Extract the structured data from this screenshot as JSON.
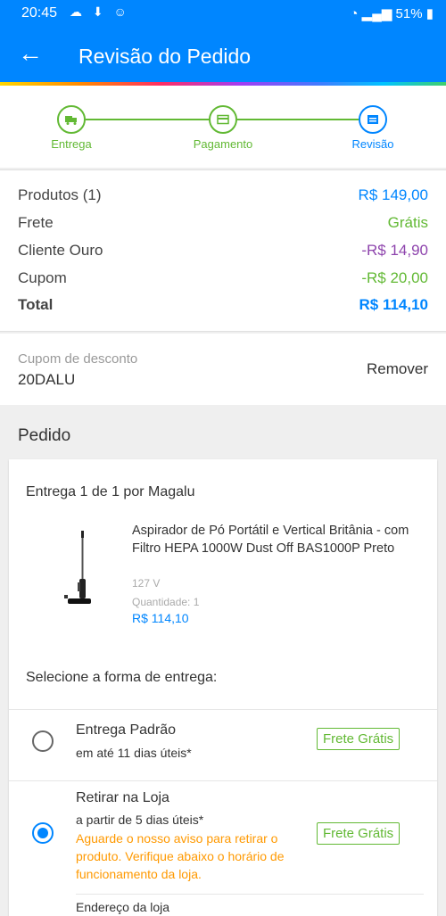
{
  "status_bar": {
    "time": "20:45",
    "battery": "51%"
  },
  "header": {
    "title": "Revisão do Pedido"
  },
  "stepper": {
    "steps": [
      {
        "label": "Entrega",
        "icon": "truck-icon"
      },
      {
        "label": "Pagamento",
        "icon": "card-icon"
      },
      {
        "label": "Revisão",
        "icon": "review-icon"
      }
    ]
  },
  "summary": {
    "rows": [
      {
        "label": "Produtos (1)",
        "value": "R$ 149,00",
        "color": "#0086ff"
      },
      {
        "label": "Frete",
        "value": "Grátis",
        "color": "#62b934"
      },
      {
        "label": "Cliente Ouro",
        "value": "-R$ 14,90",
        "color": "#8e44ad"
      },
      {
        "label": "Cupom",
        "value": "-R$ 20,00",
        "color": "#62b934"
      }
    ],
    "total": {
      "label": "Total",
      "value": "R$ 114,10",
      "color": "#0086ff"
    }
  },
  "coupon": {
    "label": "Cupom de desconto",
    "code": "20DALU",
    "remove_label": "Remover"
  },
  "order": {
    "section_title": "Pedido",
    "delivery_info": "Entrega 1 de 1 por Magalu",
    "product": {
      "name": "Aspirador de Pó Portátil e Vertical Britânia - com Filtro HEPA 1000W Dust Off BAS1000P Preto",
      "voltage": "127 V",
      "quantity": "Quantidade:  1",
      "price": "R$ 114,10"
    },
    "select_label": "Selecione a forma de entrega:",
    "options": [
      {
        "title": "Entrega Padrão",
        "subtitle": "em até 11 dias úteis*",
        "badge": "Frete Grátis",
        "selected": false
      },
      {
        "title": "Retirar na Loja",
        "subtitle": "a partir de 5 dias úteis*",
        "warning": "Aguarde o nosso aviso para retirar o produto. Verifique abaixo o horário de funcionamento da loja.",
        "badge": "Frete Grátis",
        "selected": true,
        "address_label": "Endereço da loja"
      }
    ]
  }
}
